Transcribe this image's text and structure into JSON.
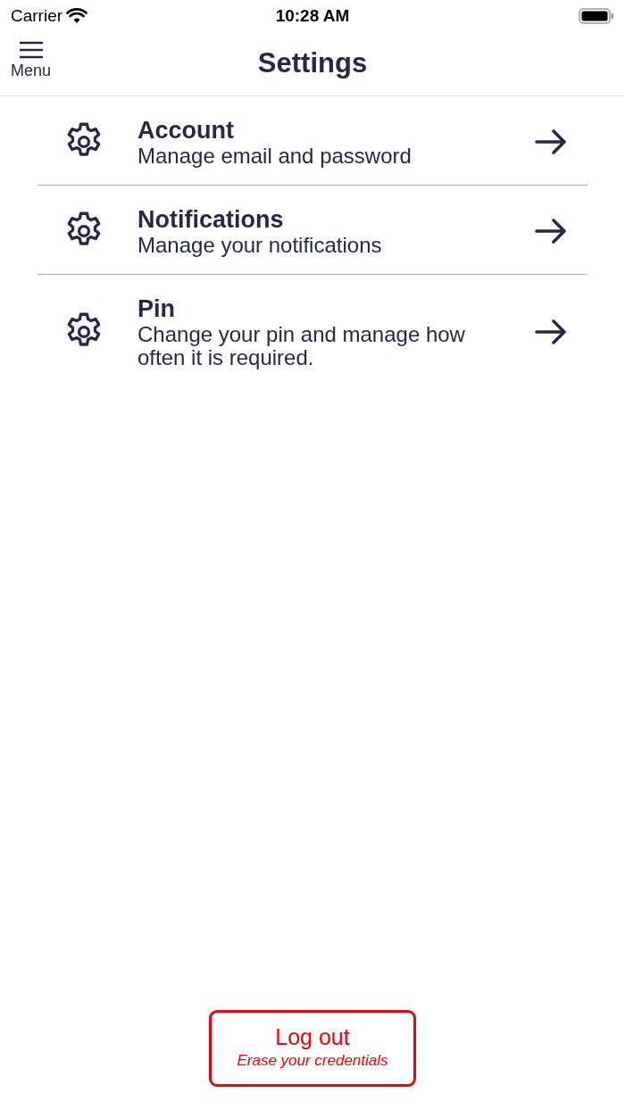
{
  "status_bar": {
    "carrier": "Carrier",
    "time": "10:28 AM"
  },
  "nav_bar": {
    "menu_label": "Menu",
    "title": "Settings"
  },
  "items": [
    {
      "title": "Account",
      "description": "Manage email and password"
    },
    {
      "title": "Notifications",
      "description": "Manage your notifications"
    },
    {
      "title": "Pin",
      "description": "Change your pin and manage how often it is required."
    }
  ],
  "logout_button": {
    "label": "Log out",
    "sublabel": "Erase your credentials"
  }
}
